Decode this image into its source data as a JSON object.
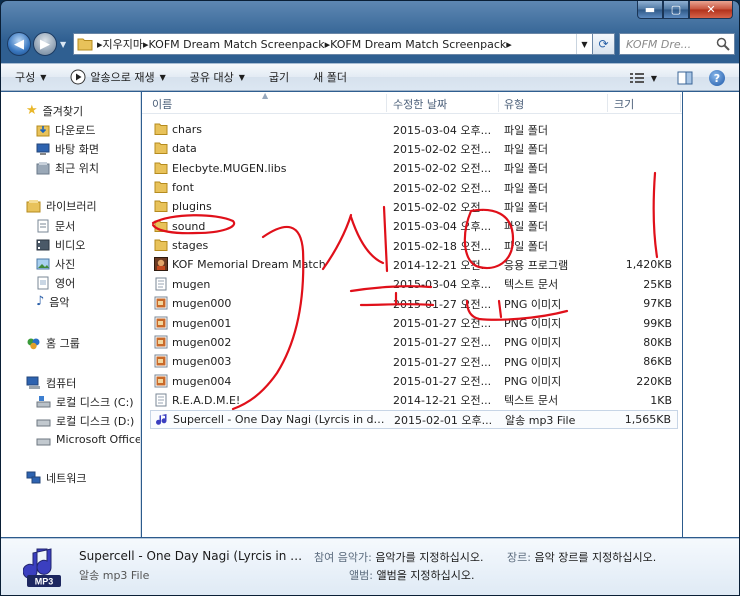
{
  "address": {
    "crumbs": [
      "지우지마",
      "KOFM Dream Match Screenpack",
      "KOFM Dream Match Screenpack"
    ]
  },
  "search": {
    "placeholder": "KOFM Dre..."
  },
  "toolbar": {
    "organize": "구성",
    "play_with": "알송으로 재생",
    "share_with": "공유 대상",
    "burn": "굽기",
    "new_folder": "새 폴더"
  },
  "nav": {
    "favorites": "즐겨찾기",
    "downloads": "다운로드",
    "desktop": "바탕 화면",
    "recent": "최근 위치",
    "libraries": "라이브러리",
    "documents": "문서",
    "videos": "비디오",
    "pictures": "사진",
    "english": "영어",
    "music": "음악",
    "homegroup": "홈 그룹",
    "computer": "컴퓨터",
    "local_c": "로컬 디스크 (C:)",
    "local_d": "로컬 디스크 (D:)",
    "office": "Microsoft Office",
    "network": "네트워크"
  },
  "columns": {
    "name": "이름",
    "date": "수정한 날짜",
    "type": "유형",
    "size": "크기"
  },
  "files": [
    {
      "icon": "folder",
      "name": "chars",
      "date": "2015-03-04 오후...",
      "type": "파일 폴더",
      "size": ""
    },
    {
      "icon": "folder",
      "name": "data",
      "date": "2015-02-02 오전...",
      "type": "파일 폴더",
      "size": ""
    },
    {
      "icon": "folder",
      "name": "Elecbyte.MUGEN.libs",
      "date": "2015-02-02 오전...",
      "type": "파일 폴더",
      "size": ""
    },
    {
      "icon": "folder",
      "name": "font",
      "date": "2015-02-02 오전...",
      "type": "파일 폴더",
      "size": ""
    },
    {
      "icon": "folder",
      "name": "plugins",
      "date": "2015-02-02 오전...",
      "type": "파일 폴더",
      "size": ""
    },
    {
      "icon": "folder",
      "name": "sound",
      "date": "2015-03-04 오후...",
      "type": "파일 폴더",
      "size": ""
    },
    {
      "icon": "folder",
      "name": "stages",
      "date": "2015-02-18 오전...",
      "type": "파일 폴더",
      "size": ""
    },
    {
      "icon": "app",
      "name": "KOF Memorial Dream Match",
      "date": "2014-12-21 오전...",
      "type": "응용 프로그램",
      "size": "1,420KB"
    },
    {
      "icon": "text",
      "name": "mugen",
      "date": "2015-03-04 오후...",
      "type": "텍스트 문서",
      "size": "25KB"
    },
    {
      "icon": "image",
      "name": "mugen000",
      "date": "2015-01-27 오전...",
      "type": "PNG 이미지",
      "size": "97KB"
    },
    {
      "icon": "image",
      "name": "mugen001",
      "date": "2015-01-27 오전...",
      "type": "PNG 이미지",
      "size": "99KB"
    },
    {
      "icon": "image",
      "name": "mugen002",
      "date": "2015-01-27 오전...",
      "type": "PNG 이미지",
      "size": "80KB"
    },
    {
      "icon": "image",
      "name": "mugen003",
      "date": "2015-01-27 오전...",
      "type": "PNG 이미지",
      "size": "86KB"
    },
    {
      "icon": "image",
      "name": "mugen004",
      "date": "2015-01-27 오전...",
      "type": "PNG 이미지",
      "size": "220KB"
    },
    {
      "icon": "text",
      "name": "R.E.A.D.M.E!",
      "date": "2014-12-21 오전...",
      "type": "텍스트 문서",
      "size": "1KB"
    },
    {
      "icon": "music",
      "name": "Supercell - One Day Nagi (Lyrcis in des...",
      "date": "2015-02-01 오후...",
      "type": "알송 mp3 File",
      "size": "1,565KB"
    }
  ],
  "details": {
    "name": "Supercell - One Day Nagi (Lyrcis in des...",
    "type": "알송 mp3 File",
    "artist_label": "참여 음악가:",
    "artist_value": "음악가를 지정하십시오.",
    "genre_label": "장르:",
    "genre_value": "음악 장르를 지정하십시오.",
    "album_label": "앨범:",
    "album_value": "앨범을 지정하십시오.",
    "thumb_label": "MP3"
  },
  "colors": {
    "accent": "#2c5a8b",
    "selection": "#c7d5e6",
    "marker": "#e0101a"
  }
}
